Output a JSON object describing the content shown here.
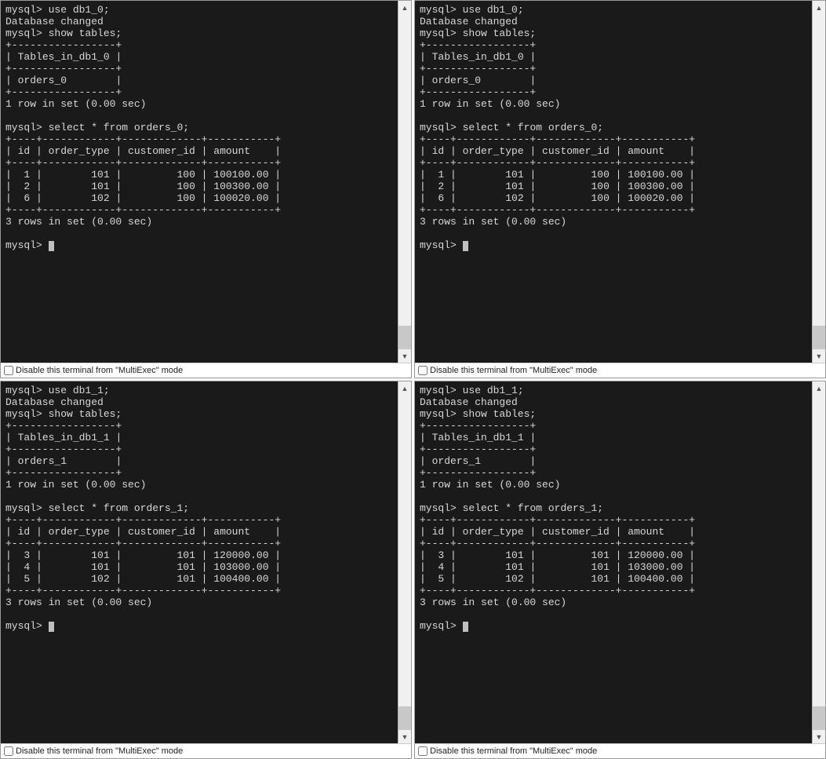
{
  "footer_label": "Disable this terminal from \"MultiExec\" mode",
  "prompt": "mysql>",
  "cursor_glyph": " ",
  "panes": [
    {
      "db": "db1_0",
      "tables_header": "Tables_in_db1_0",
      "table_name": "orders_0",
      "show_tables_footer": "1 row in set (0.00 sec)",
      "select_stmt": "select * from orders_0;",
      "columns": [
        "id",
        "order_type",
        "customer_id",
        "amount"
      ],
      "rows": [
        {
          "id": "1",
          "order_type": "101",
          "customer_id": "100",
          "amount": "100100.00"
        },
        {
          "id": "2",
          "order_type": "101",
          "customer_id": "100",
          "amount": "100300.00"
        },
        {
          "id": "6",
          "order_type": "102",
          "customer_id": "100",
          "amount": "100020.00"
        }
      ],
      "rows_footer": "3 rows in set (0.00 sec)"
    },
    {
      "db": "db1_0",
      "tables_header": "Tables_in_db1_0",
      "table_name": "orders_0",
      "show_tables_footer": "1 row in set (0.00 sec)",
      "select_stmt": "select * from orders_0;",
      "columns": [
        "id",
        "order_type",
        "customer_id",
        "amount"
      ],
      "rows": [
        {
          "id": "1",
          "order_type": "101",
          "customer_id": "100",
          "amount": "100100.00"
        },
        {
          "id": "2",
          "order_type": "101",
          "customer_id": "100",
          "amount": "100300.00"
        },
        {
          "id": "6",
          "order_type": "102",
          "customer_id": "100",
          "amount": "100020.00"
        }
      ],
      "rows_footer": "3 rows in set (0.00 sec)"
    },
    {
      "db": "db1_1",
      "tables_header": "Tables_in_db1_1",
      "table_name": "orders_1",
      "show_tables_footer": "1 row in set (0.00 sec)",
      "select_stmt": "select * from orders_1;",
      "columns": [
        "id",
        "order_type",
        "customer_id",
        "amount"
      ],
      "rows": [
        {
          "id": "3",
          "order_type": "101",
          "customer_id": "101",
          "amount": "120000.00"
        },
        {
          "id": "4",
          "order_type": "101",
          "customer_id": "101",
          "amount": "103000.00"
        },
        {
          "id": "5",
          "order_type": "102",
          "customer_id": "101",
          "amount": "100400.00"
        }
      ],
      "rows_footer": "3 rows in set (0.00 sec)"
    },
    {
      "db": "db1_1",
      "tables_header": "Tables_in_db1_1",
      "table_name": "orders_1",
      "show_tables_footer": "1 row in set (0.00 sec)",
      "select_stmt": "select * from orders_1;",
      "columns": [
        "id",
        "order_type",
        "customer_id",
        "amount"
      ],
      "rows": [
        {
          "id": "3",
          "order_type": "101",
          "customer_id": "101",
          "amount": "120000.00"
        },
        {
          "id": "4",
          "order_type": "101",
          "customer_id": "101",
          "amount": "103000.00"
        },
        {
          "id": "5",
          "order_type": "102",
          "customer_id": "101",
          "amount": "100400.00"
        }
      ],
      "rows_footer": "3 rows in set (0.00 sec)"
    }
  ]
}
